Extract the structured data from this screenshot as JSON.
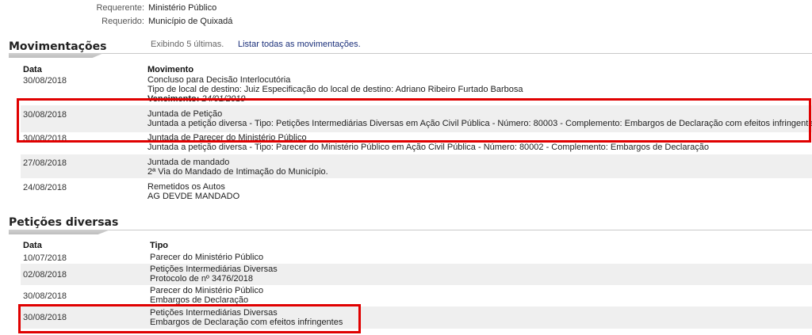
{
  "parties": [
    {
      "label": "Requerente:",
      "value": "Ministério Público"
    },
    {
      "label": "Requerido:",
      "value": "Município de Quixadá"
    }
  ],
  "movimentacoes": {
    "title": "Movimentações",
    "info": "Exibindo 5 últimas.",
    "link": "Listar todas as movimentações.",
    "headers": {
      "date": "Data",
      "movement": "Movimento"
    },
    "rows": [
      {
        "date": "30/08/2018",
        "title": "Concluso para Decisão Interlocutória",
        "detail": "Tipo de local de destino: Juiz Especificação do local de destino: Adriano Ribeiro Furtado Barbosa",
        "extra_label": "Vencimento:",
        "extra_value": "24/01/2019"
      },
      {
        "date": "30/08/2018",
        "title": "Juntada de Petição",
        "detail": "Juntada a petição diversa - Tipo: Petições Intermediárias Diversas em Ação Civil Pública - Número: 80003 - Complemento: Embargos de Declaração com efeitos infringentes"
      },
      {
        "date": "30/08/2018",
        "title": "Juntada de Parecer do Ministério Público",
        "detail": "Juntada a petição diversa - Tipo: Parecer do Ministério Público em Ação Civil Pública - Número: 80002 - Complemento: Embargos de Declaração"
      },
      {
        "date": "27/08/2018",
        "title": "Juntada de mandado",
        "detail": "2ª Via do Mandado de Intimação do Município."
      },
      {
        "date": "24/08/2018",
        "title": "Remetidos os Autos",
        "detail": "AG DEVDE MANDADO"
      }
    ]
  },
  "peticoes": {
    "title": "Petições diversas",
    "headers": {
      "date": "Data",
      "type": "Tipo"
    },
    "rows": [
      {
        "date": "10/07/2018",
        "line1": "Parecer do Ministério Público",
        "line2": ""
      },
      {
        "date": "02/08/2018",
        "line1": "Petições Intermediárias Diversas",
        "line2": "Protocolo de nº 3476/2018"
      },
      {
        "date": "30/08/2018",
        "line1": "Parecer do Ministério Público",
        "line2": "Embargos de Declaração"
      },
      {
        "date": "30/08/2018",
        "line1": "Petições Intermediárias Diversas",
        "line2": "Embargos de Declaração com efeitos infringentes"
      }
    ]
  },
  "colors": {
    "highlight": "#e00000",
    "link": "#1a2f7a",
    "row_shade": "#efefef"
  }
}
